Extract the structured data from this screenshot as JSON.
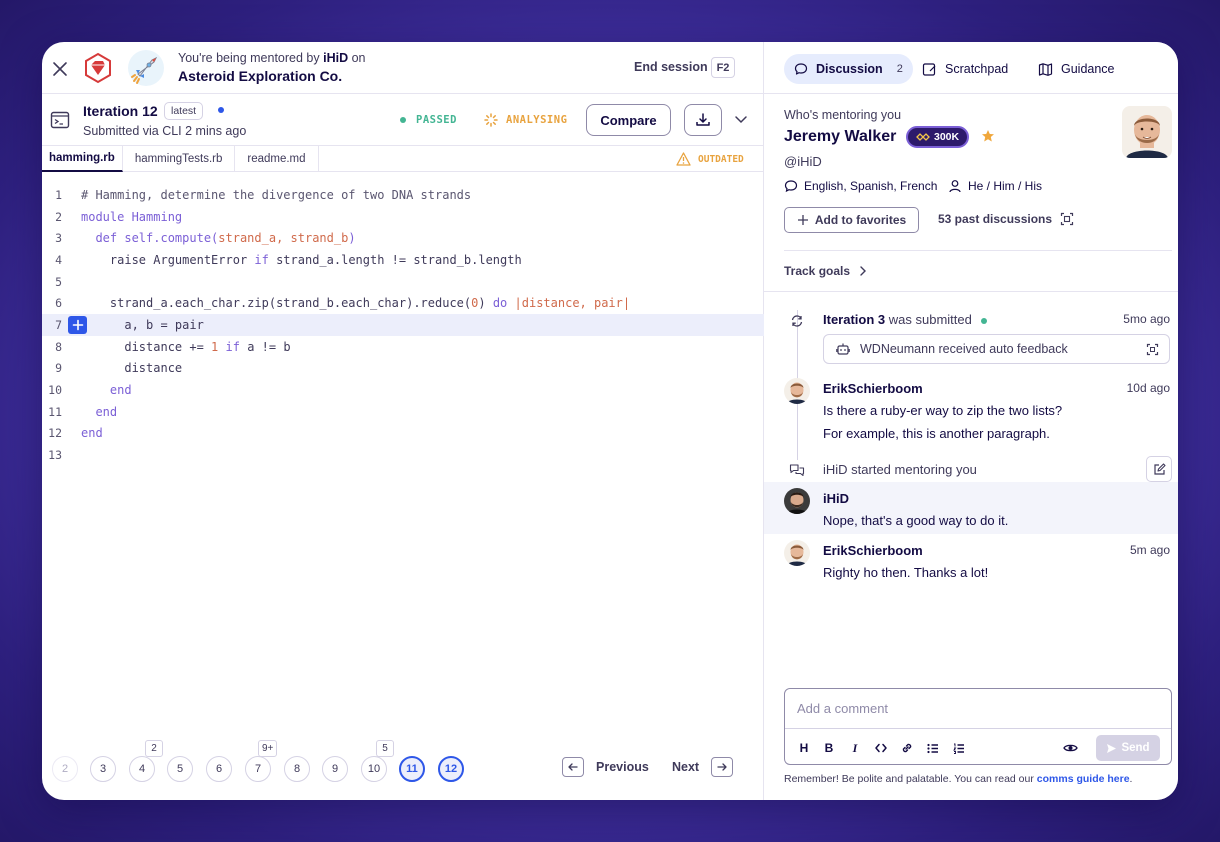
{
  "session": {
    "mentor_prefix": "You're being mentored by",
    "mentor_handle": "iHiD",
    "mentor_suffix": "on",
    "exercise_title": "Asteroid Exploration Co.",
    "end_session_label": "End session",
    "end_session_key": "F2"
  },
  "iteration": {
    "title": "Iteration 12",
    "latest_label": "latest",
    "submitted": "Submitted via CLI 2 mins ago",
    "passed_label": "PASSED",
    "analysing_label": "ANALYSING",
    "compare_label": "Compare"
  },
  "files": {
    "tabs": [
      "hamming.rb",
      "hammingTests.rb",
      "readme.md"
    ],
    "active": "hamming.rb",
    "outdated_label": "OUTDATED"
  },
  "code": {
    "highlighted_line": 7,
    "lines": [
      {
        "n": "1",
        "text": "# Hamming, determine the divergence of two DNA strands"
      },
      {
        "n": "2",
        "text": "module Hamming"
      },
      {
        "n": "3",
        "text": "  def self.compute(strand_a, strand_b)"
      },
      {
        "n": "4",
        "text": "    raise ArgumentError if strand_a.length != strand_b.length"
      },
      {
        "n": "5",
        "text": ""
      },
      {
        "n": "6",
        "text": "    strand_a.each_char.zip(strand_b.each_char).reduce(0) do |distance, pair|"
      },
      {
        "n": "7",
        "text": "      a, b = pair"
      },
      {
        "n": "8",
        "text": "      distance += 1 if a != b"
      },
      {
        "n": "9",
        "text": "      distance"
      },
      {
        "n": "10",
        "text": "    end"
      },
      {
        "n": "11",
        "text": "  end"
      },
      {
        "n": "12",
        "text": "end"
      },
      {
        "n": "13",
        "text": ""
      }
    ]
  },
  "pagination": {
    "pages": [
      "2",
      "3",
      "4",
      "5",
      "6",
      "7",
      "8",
      "9",
      "10",
      "11",
      "12"
    ],
    "badges": {
      "4": "2",
      "7": "9+",
      "10": "5"
    },
    "current": [
      "11",
      "12"
    ],
    "previous_label": "Previous",
    "next_label": "Next"
  },
  "right_tabs": {
    "discussion": "Discussion",
    "discussion_count": "2",
    "scratchpad": "Scratchpad",
    "guidance": "Guidance"
  },
  "mentor": {
    "heading": "Who's mentoring you",
    "name": "Jeremy Walker",
    "reputation": "300K",
    "handle": "@iHiD",
    "languages": "English, Spanish, French",
    "pronouns": "He / Him / His",
    "favorite_label": "Add to favorites",
    "past_discussions": "53 past discussions",
    "track_goals": "Track goals"
  },
  "timeline": {
    "iteration_event": {
      "bold": "Iteration 3",
      "rest": "was submitted",
      "time": "5mo ago"
    },
    "auto_feedback": "WDNeumann received auto feedback",
    "post1": {
      "author": "ErikSchierboom",
      "time": "10d ago",
      "line1": "Is there a ruby-er way to zip the two lists?",
      "line2": "For example, this is another paragraph."
    },
    "started": "iHiD started mentoring you",
    "post2": {
      "author": "iHiD",
      "line1": "Nope, that's a good way to do it."
    },
    "post3": {
      "author": "ErikSchierboom",
      "time": "5m ago",
      "line1": "Righty ho then. Thanks a lot!"
    }
  },
  "composer": {
    "placeholder": "Add a comment",
    "send_label": "Send",
    "tools": [
      "H",
      "B",
      "I"
    ],
    "remember_text": "Remember! Be polite and palatable. You can read our",
    "guide_link": "comms guide here",
    "guide_suffix": "."
  },
  "colors": {
    "accent": "#2e57e8",
    "passed": "#43b593",
    "warning": "#e8a33f",
    "ruby": "#d63a3a"
  }
}
